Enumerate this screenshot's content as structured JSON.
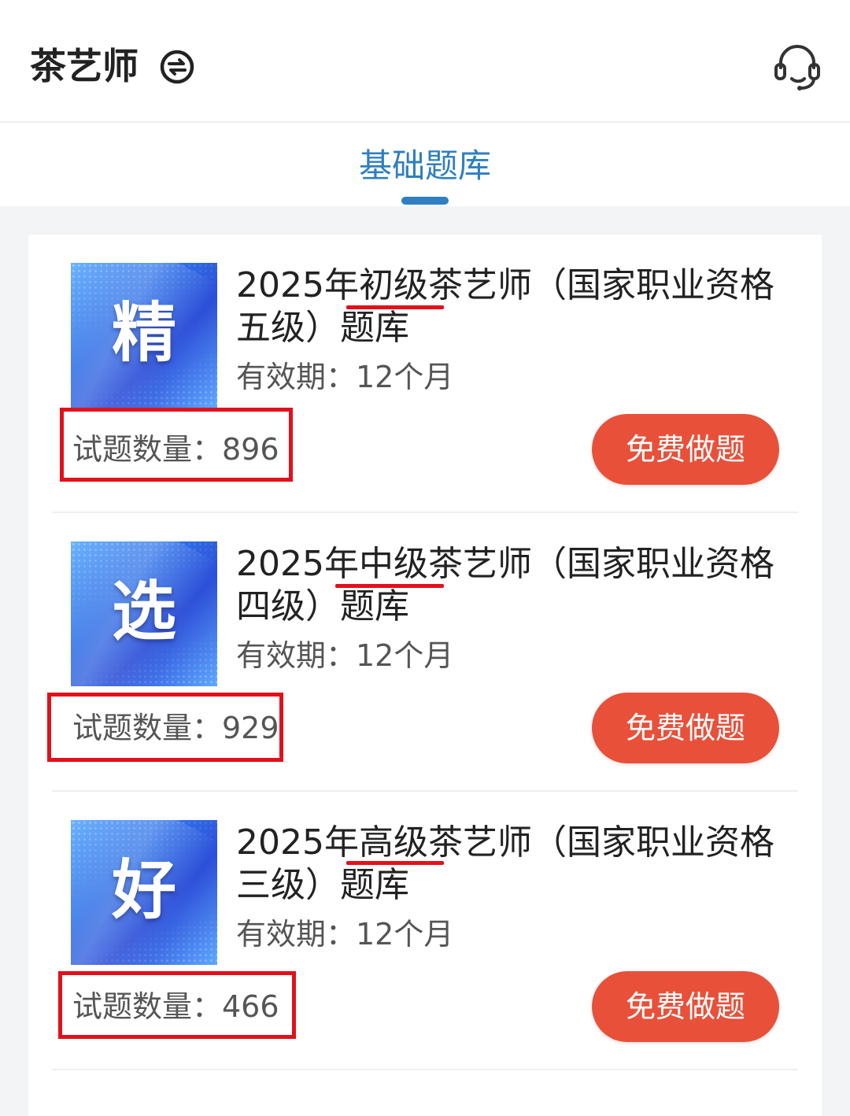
{
  "header": {
    "title": "茶艺师",
    "switch_icon": "switch-circle-icon",
    "support_icon": "headset-icon"
  },
  "tabs": [
    {
      "label": "基础题库",
      "active": true
    }
  ],
  "items": [
    {
      "badge": "精",
      "title": "2025年初级茶艺师（国家职业资格五级）题库",
      "validity": "有效期：12个月",
      "count": "试题数量：896",
      "button": "免费做题"
    },
    {
      "badge": "选",
      "title": "2025年中级茶艺师（国家职业资格四级）题库",
      "validity": "有效期：12个月",
      "count": "试题数量：929",
      "button": "免费做题"
    },
    {
      "badge": "好",
      "title": "2025年高级茶艺师（国家职业资格三级）题库",
      "validity": "有效期：12个月",
      "count": "试题数量：466",
      "button": "免费做题"
    }
  ],
  "colors": {
    "accent_blue": "#2f7fc1",
    "button_red": "#e8503a",
    "annotation_red": "#e3101a"
  }
}
